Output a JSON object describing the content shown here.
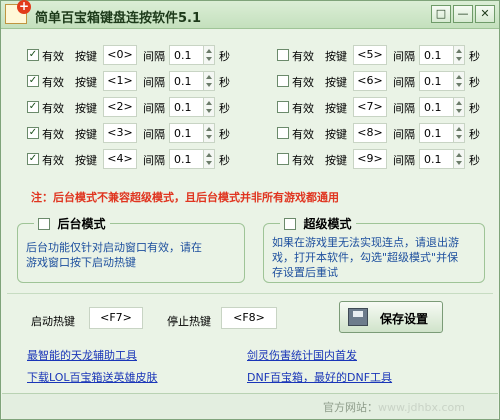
{
  "window": {
    "title": "简单百宝箱键盘连按软件5.1",
    "icon_badge": "+",
    "buttons": {
      "restore": "□",
      "minimize": "—",
      "close": "✕"
    }
  },
  "hotkeys": {
    "enabled_label": "有效",
    "key_label": "按键",
    "interval_label": "间隔",
    "unit_label": "秒",
    "rows_left": [
      {
        "checked": true,
        "key": "<0>",
        "interval": "0.1"
      },
      {
        "checked": true,
        "key": "<1>",
        "interval": "0.1"
      },
      {
        "checked": true,
        "key": "<2>",
        "interval": "0.1"
      },
      {
        "checked": true,
        "key": "<3>",
        "interval": "0.1"
      },
      {
        "checked": true,
        "key": "<4>",
        "interval": "0.1"
      }
    ],
    "rows_right": [
      {
        "checked": false,
        "key": "<5>",
        "interval": "0.1"
      },
      {
        "checked": false,
        "key": "<6>",
        "interval": "0.1"
      },
      {
        "checked": false,
        "key": "<7>",
        "interval": "0.1"
      },
      {
        "checked": false,
        "key": "<8>",
        "interval": "0.1"
      },
      {
        "checked": false,
        "key": "<9>",
        "interval": "0.1"
      }
    ]
  },
  "notice": "注：后台模式不兼容超级模式，且后台模式并非所有游戏都通用",
  "modes": {
    "background": {
      "title": "后台模式",
      "checked": false,
      "desc_line1": "后台功能仅针对启动窗口有效，请在",
      "desc_line2": "游戏窗口按下启动热键"
    },
    "super": {
      "title": "超级模式",
      "checked": false,
      "desc_line1": "如果在游戏里无法实现连点，请退出游",
      "desc_line2": "戏，打开本软件，勾选\"超级模式\"并保",
      "desc_line3": "存设置后重试"
    }
  },
  "controls": {
    "start_hotkey_label": "启动热键",
    "start_hotkey": "<F7>",
    "stop_hotkey_label": "停止热键",
    "stop_hotkey": "<F8>",
    "save_label": "保存设置"
  },
  "links": {
    "link1": "最智能的天龙辅助工具",
    "link2": "剑灵伤害统计国内首发",
    "link3": "下载LOL百宝箱送英雄皮肤",
    "link4": "DNF百宝箱，最好的DNF工具"
  },
  "watermark": {
    "label": "官方网站：",
    "site": "www.jdhbx.com"
  },
  "colors": {
    "background": "#eaf3e6",
    "notice": "#e0341f",
    "link": "#1a36b8",
    "desc": "#1d4f9e"
  }
}
